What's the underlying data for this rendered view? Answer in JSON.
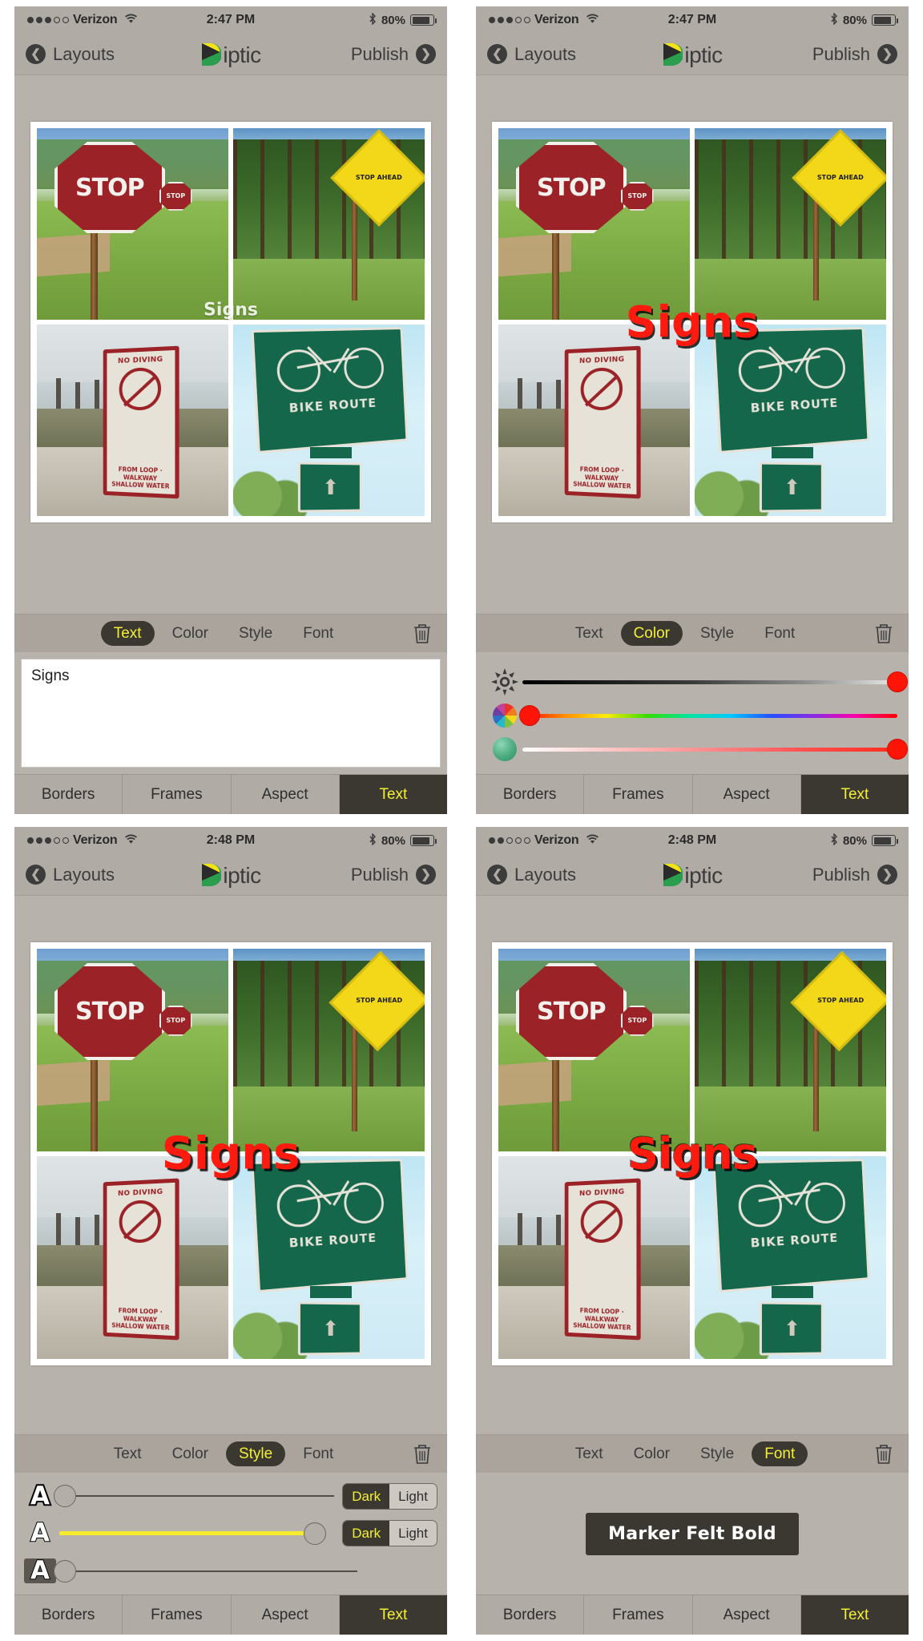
{
  "app": {
    "brand_name": "iptic",
    "brand_mark": "diptic-logo-icon",
    "back_label": "Layouts",
    "publish_label": "Publish"
  },
  "panels": [
    {
      "id": "text-panel",
      "status": {
        "carrier": "Verizon",
        "time": "2:47 PM",
        "battery": "80%",
        "wifi_icon": "wifi-icon",
        "bluetooth_icon": "bluetooth-icon",
        "signal_dots_filled": 3,
        "signal_dots_total": 5
      },
      "editor_tabs": [
        {
          "label": "Text",
          "active": true
        },
        {
          "label": "Color",
          "active": false
        },
        {
          "label": "Style",
          "active": false
        },
        {
          "label": "Font",
          "active": false
        }
      ],
      "trash_icon": "trash-icon",
      "text_input": {
        "value": "Signs",
        "placeholder": ""
      },
      "overlay_text": "Signs",
      "bottom_tabs": [
        {
          "label": "Borders",
          "active": false
        },
        {
          "label": "Frames",
          "active": false
        },
        {
          "label": "Aspect",
          "active": false
        },
        {
          "label": "Text",
          "active": true
        }
      ]
    },
    {
      "id": "color-panel",
      "status": {
        "carrier": "Verizon",
        "time": "2:47 PM",
        "battery": "80%",
        "wifi_icon": "wifi-icon",
        "bluetooth_icon": "bluetooth-icon",
        "signal_dots_filled": 3,
        "signal_dots_total": 5
      },
      "editor_tabs": [
        {
          "label": "Text",
          "active": false
        },
        {
          "label": "Color",
          "active": true
        },
        {
          "label": "Style",
          "active": false
        },
        {
          "label": "Font",
          "active": false
        }
      ],
      "trash_icon": "trash-icon",
      "overlay_text": "Signs",
      "color_sliders": [
        {
          "name": "brightness",
          "icon": "sun-icon",
          "knob_position_pct": 100,
          "knob_color": "#ff1408"
        },
        {
          "name": "hue",
          "icon": "color-wheel-icon",
          "knob_position_pct": 2,
          "knob_color": "#ff1408"
        },
        {
          "name": "saturation",
          "icon": "saturation-ball-icon",
          "knob_position_pct": 100,
          "knob_color": "#ff1408"
        }
      ],
      "bottom_tabs": [
        {
          "label": "Borders",
          "active": false
        },
        {
          "label": "Frames",
          "active": false
        },
        {
          "label": "Aspect",
          "active": false
        },
        {
          "label": "Text",
          "active": true
        }
      ]
    },
    {
      "id": "style-panel",
      "status": {
        "carrier": "Verizon",
        "time": "2:48 PM",
        "battery": "80%",
        "wifi_icon": "wifi-icon",
        "bluetooth_icon": "bluetooth-icon",
        "signal_dots_filled": 3,
        "signal_dots_total": 5
      },
      "editor_tabs": [
        {
          "label": "Text",
          "active": false
        },
        {
          "label": "Color",
          "active": false
        },
        {
          "label": "Style",
          "active": true
        },
        {
          "label": "Font",
          "active": false
        }
      ],
      "trash_icon": "trash-icon",
      "overlay_text": "Signs",
      "style_rows": [
        {
          "icon": "outline-A-icon",
          "slider_pct": 2,
          "track_color": "#524d47",
          "segment": {
            "options": [
              "Dark",
              "Light"
            ],
            "selected": "Dark"
          }
        },
        {
          "icon": "glow-A-icon",
          "slider_pct": 93,
          "track_color": "#f5ec2b",
          "segment": {
            "options": [
              "Dark",
              "Light"
            ],
            "selected": "Dark"
          }
        },
        {
          "icon": "background-A-icon",
          "slider_pct": 2,
          "track_color": "#524d47",
          "segment": null
        }
      ],
      "bottom_tabs": [
        {
          "label": "Borders",
          "active": false
        },
        {
          "label": "Frames",
          "active": false
        },
        {
          "label": "Aspect",
          "active": false
        },
        {
          "label": "Text",
          "active": true
        }
      ]
    },
    {
      "id": "font-panel",
      "status": {
        "carrier": "Verizon",
        "time": "2:48 PM",
        "battery": "80%",
        "wifi_icon": "wifi-icon",
        "bluetooth_icon": "bluetooth-icon",
        "signal_dots_filled": 2,
        "signal_dots_total": 5
      },
      "editor_tabs": [
        {
          "label": "Text",
          "active": false
        },
        {
          "label": "Color",
          "active": false
        },
        {
          "label": "Style",
          "active": false
        },
        {
          "label": "Font",
          "active": true
        }
      ],
      "trash_icon": "trash-icon",
      "overlay_text": "Signs",
      "font_chip": "Marker Felt Bold",
      "bottom_tabs": [
        {
          "label": "Borders",
          "active": false
        },
        {
          "label": "Frames",
          "active": false
        },
        {
          "label": "Aspect",
          "active": false
        },
        {
          "label": "Text",
          "active": true
        }
      ]
    }
  ],
  "collage": {
    "cells": [
      {
        "name": "stop-sign-photo",
        "sign_text": "STOP",
        "mini_sign_text": "STOP"
      },
      {
        "name": "stop-ahead-photo",
        "sign_text": "STOP AHEAD"
      },
      {
        "name": "no-diving-photo",
        "top_text": "NO DIVING",
        "bottom_text": "FROM LOOP · WALKWAY SHALLOW WATER"
      },
      {
        "name": "bike-route-photo",
        "sign_text": "BIKE ROUTE"
      }
    ]
  },
  "colors": {
    "accent_yellow": "#f2ef36",
    "chrome_gray": "#b0aba4",
    "panel_gray": "#b7b2ab",
    "dark_pill": "#3b3731",
    "overlay_red": "#ff1a10",
    "sign_red": "#9b2226",
    "sign_yellow": "#f2d818",
    "sign_green": "#14674a"
  }
}
